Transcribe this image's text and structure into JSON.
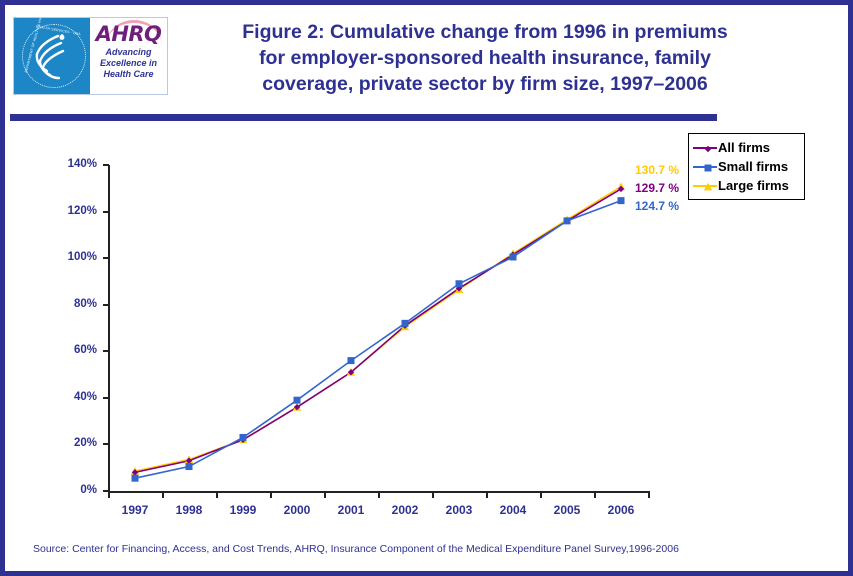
{
  "header": {
    "title_lines": [
      "Figure 2: Cumulative change from 1996 in premiums",
      "for employer-sponsored health insurance, family",
      "coverage, private sector by firm size, 1997–2006"
    ],
    "logo": {
      "agency_wordmark": "AHRQ",
      "tagline_lines": [
        "Advancing",
        "Excellence in",
        "Health Care"
      ],
      "seal_text_top": "· HEALTH SERVICES · USA",
      "seal_text_left": "DEPARTMENT OF HEALTH & HUMAN"
    }
  },
  "source": {
    "text": "Source: Center for Financing, Access, and Cost Trends, AHRQ, Insurance Component of the Medical Expenditure Panel Survey,1996-2006"
  },
  "legend": {
    "position": "right",
    "entries": [
      {
        "label": "All firms",
        "color": "#800080",
        "marker": "diamond"
      },
      {
        "label": "Small firms",
        "color": "#3366CC",
        "marker": "square"
      },
      {
        "label": "Large firms",
        "color": "#FFCC00",
        "marker": "triangle"
      }
    ]
  },
  "end_labels": [
    {
      "text": "130.7 %",
      "color": "#FFCC00"
    },
    {
      "text": "129.7 %",
      "color": "#800080"
    },
    {
      "text": "124.7 %",
      "color": "#3366CC"
    }
  ],
  "chart_data": {
    "type": "line",
    "title": "Figure 2: Cumulative change from 1996 in premiums for employer-sponsored health insurance, family coverage, private sector by firm size, 1997–2006",
    "xlabel": "",
    "ylabel": "",
    "categories": [
      "1997",
      "1998",
      "1999",
      "2000",
      "2001",
      "2002",
      "2003",
      "2004",
      "2005",
      "2006"
    ],
    "ytick_labels": [
      "0%",
      "20%",
      "40%",
      "60%",
      "80%",
      "100%",
      "120%",
      "140%"
    ],
    "ytick_values": [
      0,
      20,
      40,
      60,
      80,
      100,
      120,
      140
    ],
    "ylim": [
      0,
      140
    ],
    "grid": false,
    "series": [
      {
        "name": "All firms",
        "color": "#800080",
        "marker": "diamond",
        "values": [
          8.0,
          13.0,
          22.0,
          36.0,
          51.0,
          71.0,
          87.0,
          101.5,
          116.0,
          129.7
        ]
      },
      {
        "name": "Small firms",
        "color": "#3366CC",
        "marker": "square",
        "values": [
          5.5,
          10.5,
          23.0,
          39.0,
          56.0,
          72.0,
          89.0,
          100.5,
          116.0,
          124.7
        ]
      },
      {
        "name": "Large firms",
        "color": "#FFCC00",
        "marker": "triangle",
        "values": [
          8.5,
          13.5,
          22.0,
          36.0,
          51.0,
          70.5,
          86.5,
          102.0,
          116.5,
          130.7
        ]
      }
    ]
  }
}
